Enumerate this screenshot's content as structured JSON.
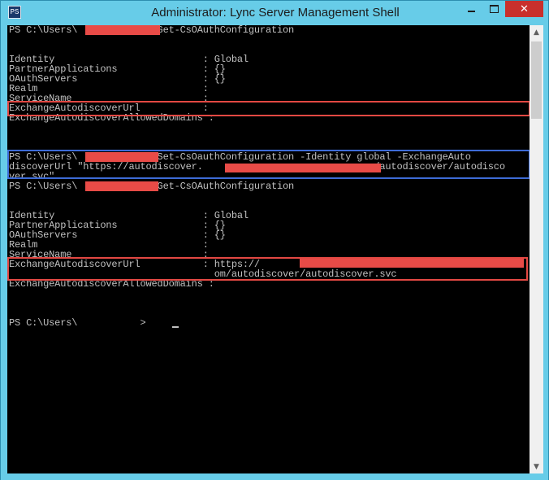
{
  "window": {
    "title": "Administrator: Lync Server Management Shell",
    "app_icon_glyph": "PS"
  },
  "controls": {
    "minimize": "minimize-icon",
    "maximize": "maximize-icon",
    "close": "✕"
  },
  "console": {
    "lines": [
      "PS C:\\Users\\            > Get-CsOAuthConfiguration",
      "",
      "",
      "Identity                          : Global",
      "PartnerApplications               : {}",
      "OAuthServers                      : {}",
      "Realm                             :",
      "ServiceName                       :",
      "ExchangeAutodiscoverUrl           :",
      "ExchangeAutodiscoverAllowedDomains :",
      "",
      "",
      "",
      "PS C:\\Users\\            > Set-CsOauthConfiguration -Identity global -ExchangeAuto",
      "discoverUrl \"https://autodiscover.                              /autodiscover/autodisco",
      "ver.svc\"",
      "PS C:\\Users\\            > Get-CsOAuthConfiguration",
      "",
      "",
      "Identity                          : Global",
      "PartnerApplications               : {}",
      "OAuthServers                      : {}",
      "Realm                             :",
      "ServiceName                       :",
      "ExchangeAutodiscoverUrl           : https://",
      "                                    om/autodiscover/autodiscover.svc",
      "ExchangeAutodiscoverAllowedDomains :",
      "",
      "",
      "",
      "PS C:\\Users\\           > "
    ]
  },
  "colors": {
    "console_bg": "#000000",
    "console_text": "#c0c0c0",
    "redaction": "#e84b47",
    "highlight_red": "#e34843",
    "highlight_blue": "#3d6bd6",
    "title_bar": "#67cce8"
  }
}
